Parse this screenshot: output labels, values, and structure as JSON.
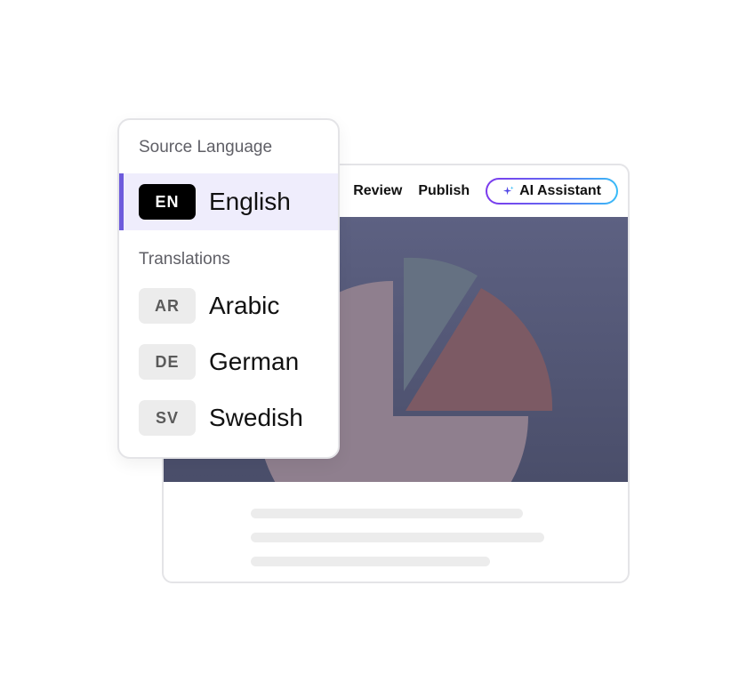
{
  "toolbar": {
    "review_label": "Review",
    "publish_label": "Publish",
    "ai_assistant_label": "AI Assistant"
  },
  "language_panel": {
    "source_title": "Source Language",
    "source": {
      "code": "EN",
      "name": "English"
    },
    "translations_title": "Translations",
    "translations": [
      {
        "code": "AR",
        "name": "Arabic"
      },
      {
        "code": "DE",
        "name": "German"
      },
      {
        "code": "SV",
        "name": "Swedish"
      }
    ]
  },
  "colors": {
    "accent": "#6d5bdc",
    "source_highlight": "#efedfc",
    "hero_background": "#555a7a",
    "pie_large": "#8f7f8e",
    "pie_red": "#7c5a64",
    "pie_teal": "#657182"
  },
  "icons": {
    "ai_assistant": "sparkle-icon"
  }
}
